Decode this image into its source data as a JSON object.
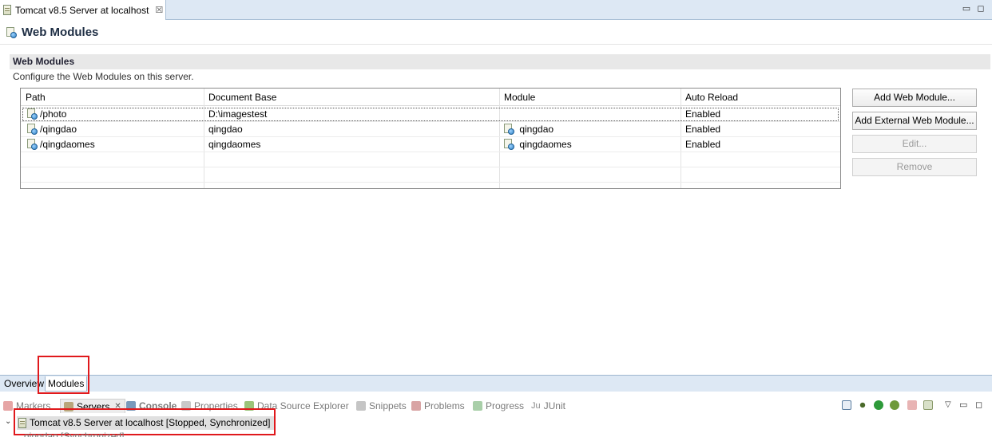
{
  "editor_tab": {
    "title": "Tomcat v8.5 Server at localhost",
    "close": "☒"
  },
  "window_controls": {
    "minimize": "▭",
    "maximize": "◻"
  },
  "header": {
    "title": "Web Modules"
  },
  "section": {
    "title": "Web Modules",
    "description": "Configure the Web Modules on this server."
  },
  "table": {
    "columns": [
      "Path",
      "Document Base",
      "Module",
      "Auto Reload"
    ],
    "rows": [
      {
        "path": "/photo",
        "document_base": "D:\\imagestest",
        "module": "",
        "auto_reload": "Enabled"
      },
      {
        "path": "/qingdao",
        "document_base": "qingdao",
        "module": "qingdao",
        "auto_reload": "Enabled"
      },
      {
        "path": "/qingdaomes",
        "document_base": "qingdaomes",
        "module": "qingdaomes",
        "auto_reload": "Enabled"
      }
    ]
  },
  "buttons": {
    "add_web_module": "Add Web Module...",
    "add_external": "Add External Web Module...",
    "edit": "Edit...",
    "remove": "Remove"
  },
  "form_tabs": {
    "overview": "Overview",
    "modules": "Modules"
  },
  "views": {
    "markers": "Markers",
    "servers": "Servers",
    "console": "Console",
    "properties": "Properties",
    "data_source": "Data Source Explorer",
    "snippets": "Snippets",
    "problems": "Problems",
    "progress": "Progress",
    "junit": "JUnit"
  },
  "server_entry": {
    "label": "Tomcat v8.5 Server at localhost  [Stopped, Synchronized]",
    "child": "qingdao  [Synchronized]"
  },
  "colors": {
    "highlight": "#e0191c",
    "tab_bar": "#dde8f4"
  }
}
